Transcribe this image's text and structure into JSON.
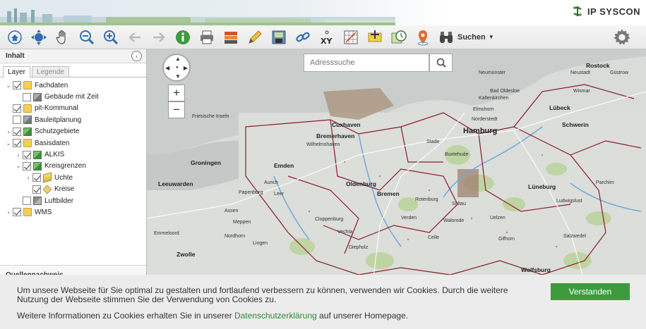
{
  "header": {
    "logo_text": "IP SYSCON"
  },
  "toolbar": {
    "search_label": "Suchen"
  },
  "sidebar": {
    "title": "Inhalt",
    "tabs": [
      {
        "label": "Layer",
        "active": true
      },
      {
        "label": "Legende",
        "active": false
      }
    ],
    "tree": [
      {
        "label": "Fachdaten",
        "level": 0,
        "expanded": true,
        "checked": true,
        "icon": "folder-icon"
      },
      {
        "label": "Gebäude mit Zeit",
        "level": 1,
        "expanded": null,
        "checked": false,
        "icon": "layer-icon"
      },
      {
        "label": "pit-Kommunal",
        "level": 0,
        "expanded": null,
        "checked": true,
        "icon": "folder-icon"
      },
      {
        "label": "Bauleitplanung",
        "level": 0,
        "expanded": null,
        "checked": false,
        "icon": "layer-icon"
      },
      {
        "label": "Schutzgebiete",
        "level": 0,
        "expanded": false,
        "checked": true,
        "icon": "layer-green-icon"
      },
      {
        "label": "Basisdaten",
        "level": 0,
        "expanded": true,
        "checked": true,
        "icon": "folder-icon"
      },
      {
        "label": "ALKIS",
        "level": 1,
        "expanded": false,
        "checked": true,
        "icon": "layer-green-icon"
      },
      {
        "label": "Kreisgrenzen",
        "level": 1,
        "expanded": true,
        "checked": true,
        "icon": "layer-green-icon"
      },
      {
        "label": "Uchte",
        "level": 2,
        "expanded": false,
        "checked": true,
        "icon": "stack-icon"
      },
      {
        "label": "Kreise",
        "level": 2,
        "expanded": null,
        "checked": true,
        "icon": "diamond-icon"
      },
      {
        "label": "Luftbilder",
        "level": 1,
        "expanded": null,
        "checked": false,
        "icon": "photo-icon"
      },
      {
        "label": "WMS",
        "level": 0,
        "expanded": false,
        "checked": true,
        "icon": "folder-icon"
      }
    ],
    "source_label": "Quellennachweis"
  },
  "map": {
    "search_placeholder": "Adresssuche",
    "zoom_in": "+",
    "zoom_out": "−",
    "labels": [
      {
        "text": "Hamburg",
        "style": "big"
      },
      {
        "text": "Bremerhaven",
        "style": "med"
      },
      {
        "text": "Lübeck",
        "style": "med"
      },
      {
        "text": "Rostock",
        "style": "med"
      },
      {
        "text": "Groningen",
        "style": "med"
      },
      {
        "text": "Leeuwarden",
        "style": "med"
      },
      {
        "text": "Bremen",
        "style": "med"
      },
      {
        "text": "Lüneburg",
        "style": "med"
      },
      {
        "text": "Schwerin",
        "style": "med"
      },
      {
        "text": "Oldenburg",
        "style": "med"
      },
      {
        "text": "Cuxhaven",
        "style": "med"
      },
      {
        "text": "Emden",
        "style": "med"
      },
      {
        "text": "Wismar",
        "style": "small"
      },
      {
        "text": "Friesische Inseln",
        "style": "small"
      },
      {
        "text": "Zwolle",
        "style": "med"
      },
      {
        "text": "Wolfsburg",
        "style": "med"
      },
      {
        "text": "Soltau",
        "style": "small"
      },
      {
        "text": "Uelzen",
        "style": "small"
      },
      {
        "text": "Stade",
        "style": "small"
      },
      {
        "text": "Kaltenkirchen",
        "style": "small"
      },
      {
        "text": "Neumünster",
        "style": "small"
      },
      {
        "text": "Elmshorn",
        "style": "small"
      },
      {
        "text": "Bad Oldesloe",
        "style": "small"
      },
      {
        "text": "Norderstedt",
        "style": "small"
      },
      {
        "text": "Neustadt",
        "style": "small"
      },
      {
        "text": "Güstrow",
        "style": "small"
      },
      {
        "text": "Emmeloord",
        "style": "small"
      },
      {
        "text": "Assen",
        "style": "small"
      },
      {
        "text": "Papenburg",
        "style": "small"
      },
      {
        "text": "Cloppenburg",
        "style": "small"
      },
      {
        "text": "Vechta",
        "style": "small"
      },
      {
        "text": "Verden",
        "style": "small"
      },
      {
        "text": "Celle",
        "style": "small"
      },
      {
        "text": "Walsrode",
        "style": "small"
      },
      {
        "text": "Rotenburg",
        "style": "small"
      },
      {
        "text": "Buxtehude",
        "style": "small"
      },
      {
        "text": "Wilhelmshaven",
        "style": "small"
      },
      {
        "text": "Aurich",
        "style": "small"
      },
      {
        "text": "Leer",
        "style": "small"
      },
      {
        "text": "Meppen",
        "style": "small"
      },
      {
        "text": "Ludwigslust",
        "style": "small"
      },
      {
        "text": "Parchim",
        "style": "small"
      },
      {
        "text": "Salzwedel",
        "style": "small"
      },
      {
        "text": "Gifhorn",
        "style": "small"
      },
      {
        "text": "Nordhorn",
        "style": "small"
      },
      {
        "text": "Lingen",
        "style": "small"
      },
      {
        "text": "Diepholz",
        "style": "small"
      }
    ]
  },
  "cookie": {
    "text": "Um unsere Webseite für Sie optimal zu gestalten und fortlaufend verbessern zu können, verwenden wir Cookies. Durch die weitere Nutzung der Webseite stimmen Sie der Verwendung von Cookies zu.",
    "more_prefix": "Weitere Informationen zu Cookies erhalten Sie in unserer ",
    "more_link": "Datenschutzerklärung",
    "more_suffix": " auf unserer Homepage.",
    "accept_label": "Verstanden"
  },
  "colors": {
    "accent_green": "#3d9a3d",
    "link_green": "#2e8b2e",
    "boundary_red": "#8b1a2b",
    "water_blue": "#6fa8dc"
  }
}
